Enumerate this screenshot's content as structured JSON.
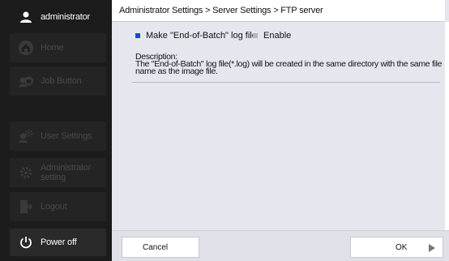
{
  "sidebar": {
    "user": {
      "icon": "user-icon",
      "label": "administrator"
    },
    "items": [
      {
        "id": "home",
        "icon": "home-icon",
        "label": "Home"
      },
      {
        "id": "job-button",
        "icon": "job-button-icon",
        "label": "Job Button"
      },
      {
        "id": "user-settings",
        "icon": "user-settings-icon",
        "label": "User Settings"
      },
      {
        "id": "administrator-setting",
        "icon": "gear-icon",
        "label_line1": "Administrator",
        "label_line2": "setting"
      },
      {
        "id": "logout",
        "icon": "logout-icon",
        "label": "Logout"
      }
    ],
    "power": {
      "icon": "power-icon",
      "label": "Power off"
    }
  },
  "header": {
    "breadcrumb": "Administrator Settings > Server Settings > FTP server"
  },
  "main": {
    "option_label": "Make \"End-of-Batch\" log file",
    "enable_label": "Enable",
    "description_title": "Description:",
    "description_text": "The \"End-of-Batch\" log file(*.log) will be created in the same directory with the same file name as the image file."
  },
  "footer": {
    "cancel_label": "Cancel",
    "ok_label": "OK"
  },
  "colors": {
    "accent": "#2244cc",
    "sidebar_bg": "#1c1c1c",
    "content_bg": "#e5e6ee"
  }
}
